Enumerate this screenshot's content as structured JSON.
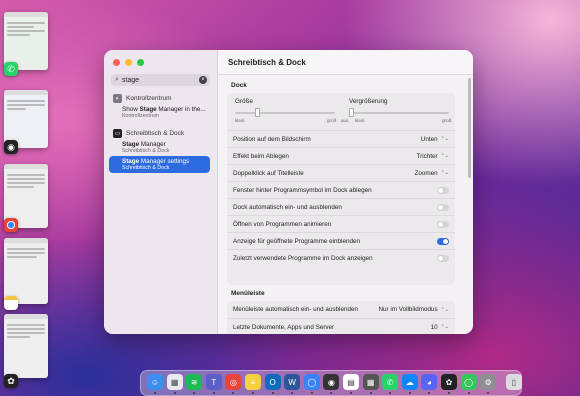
{
  "window": {
    "title": "Schreibtisch & Dock"
  },
  "sidebar": {
    "search_value": "stage",
    "categories": [
      {
        "label": "Kontrollzentrum"
      },
      {
        "label": "Schreibtisch & Dock"
      }
    ],
    "results": [
      {
        "title": "Show Stage Manager in the...",
        "sub": "Kontrollzentrum"
      },
      {
        "title": "Stage Manager",
        "sub": "Schreibtisch & Dock"
      },
      {
        "title": "Stage Manager settings",
        "sub": "Schreibtisch & Dock",
        "selected": true
      }
    ]
  },
  "dock_section": {
    "heading": "Dock",
    "size": {
      "label": "Größe",
      "min": "klein",
      "max": "groß",
      "value": 0.2
    },
    "magnification": {
      "label": "Vergrößerung",
      "min": "aus",
      "mid": "klein",
      "max": "groß",
      "value": 0.0
    },
    "rows": [
      {
        "label": "Position auf dem Bildschirm",
        "type": "popup",
        "value": "Unten"
      },
      {
        "label": "Effekt beim Ablegen",
        "type": "popup",
        "value": "Trichter"
      },
      {
        "label": "Doppelklick auf Titelleiste",
        "type": "popup",
        "value": "Zoomen"
      },
      {
        "label": "Fenster hinter Programmsymbol im Dock ablegen",
        "type": "toggle",
        "on": false
      },
      {
        "label": "Dock automatisch ein- und ausblenden",
        "type": "toggle",
        "on": false
      },
      {
        "label": "Öffnen von Programmen animieren",
        "type": "toggle",
        "on": false
      },
      {
        "label": "Anzeige für geöffnete Programme einblenden",
        "type": "toggle",
        "on": true
      },
      {
        "label": "Zuletzt verwendete Programme im Dock anzeigen",
        "type": "toggle",
        "on": false
      }
    ]
  },
  "menubar_section": {
    "heading": "Menüleiste",
    "rows": [
      {
        "label": "Menüleiste automatisch ein- und ausblenden",
        "type": "popup",
        "value": "Nur im Vollbildmodus"
      },
      {
        "label": "Letzte Dokumente, Apps und Server",
        "type": "popup",
        "value": "10"
      }
    ]
  },
  "colors": {
    "accent": "#2d6be0"
  },
  "dock_icons": [
    "finder-icon",
    "launchpad-icon",
    "spotify-icon",
    "teams-icon",
    "chrome-icon",
    "notes-icon",
    "outlook-icon",
    "word-icon",
    "messages-icon",
    "screenshot-icon",
    "calendar-icon",
    "calculator-icon",
    "whatsapp-icon",
    "bluesky-icon",
    "discord-icon",
    "chatgpt-icon",
    "imessage-icon",
    "settings-icon",
    "trash-icon"
  ]
}
